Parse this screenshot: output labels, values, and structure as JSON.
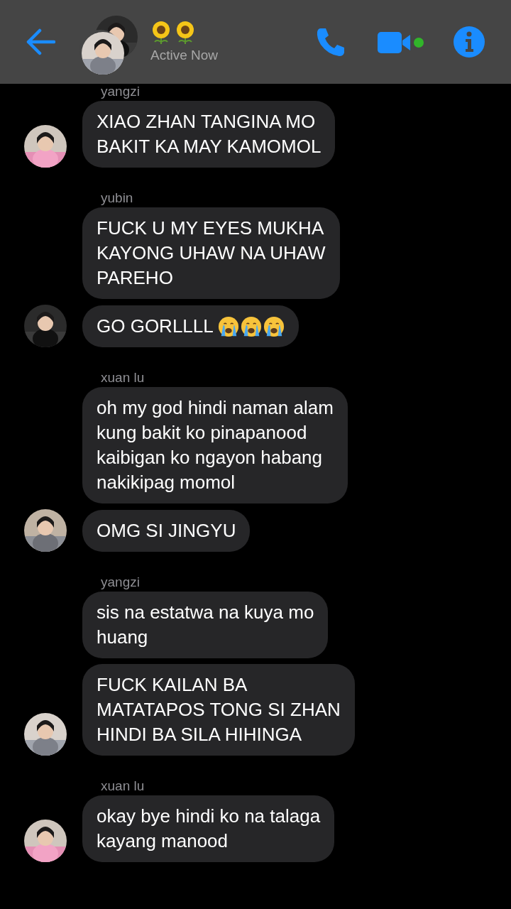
{
  "header": {
    "title_emojis": [
      {
        "kind": "sunflower"
      },
      {
        "kind": "sunflower"
      }
    ],
    "status": "Active Now",
    "video_active": true
  },
  "groups": [
    {
      "sender": "yangzi",
      "messages": [
        {
          "lines": [
            "XIAO ZHAN TANGINA MO",
            "BAKIT KA MAY KAMOMOL"
          ]
        }
      ]
    },
    {
      "sender": "yubin",
      "messages": [
        {
          "lines": [
            "FUCK U MY EYES MUKHA",
            "KAYONG UHAW NA UHAW",
            "PAREHO"
          ]
        },
        {
          "lines": [
            "GO GORLLLL"
          ],
          "emojis": [
            {
              "kind": "crying"
            },
            {
              "kind": "crying"
            },
            {
              "kind": "crying"
            }
          ]
        }
      ]
    },
    {
      "sender": "xuan lu",
      "messages": [
        {
          "lines": [
            "oh my god hindi naman alam",
            "kung bakit ko pinapanood",
            "kaibigan ko ngayon habang",
            "nakikipag momol"
          ]
        },
        {
          "lines": [
            "OMG SI JINGYU"
          ]
        }
      ]
    },
    {
      "sender": "yangzi",
      "messages": [
        {
          "lines": [
            "sis na estatwa na kuya mo",
            "huang"
          ]
        },
        {
          "lines": [
            "FUCK KAILAN BA",
            "MATATAPOS TONG SI ZHAN",
            "HINDI BA SILA HIHINGA"
          ]
        }
      ]
    },
    {
      "sender": "xuan lu",
      "messages": [
        {
          "lines": [
            "okay bye hindi ko na talaga",
            "kayang manood"
          ]
        }
      ]
    }
  ]
}
